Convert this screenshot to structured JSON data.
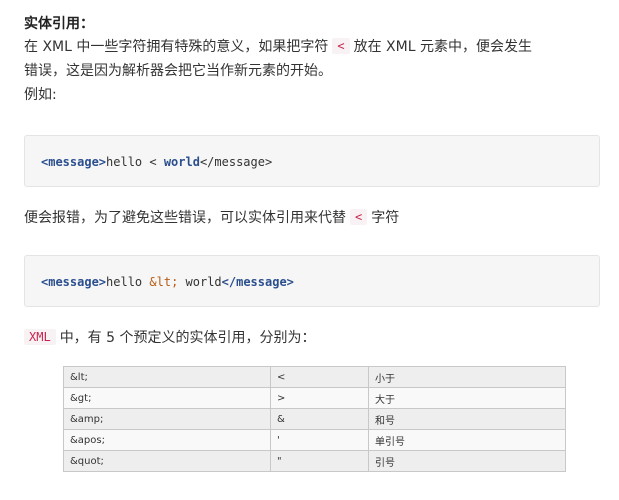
{
  "heading": "实体引用：",
  "intro": {
    "line1_before": "在 XML 中一些字符拥有特殊的意义，如果把字符",
    "line1_code": "<",
    "line1_after": "放在 XML 元素中，便会发生",
    "line2": "错误，这是因为解析器会把它当作新元素的开始。",
    "line3": "例如:"
  },
  "code1": {
    "open_tag": "<message>",
    "text": "hello < ",
    "word": "world",
    "close_tag": "</message>"
  },
  "middle": {
    "before": "便会报错，为了避免这些错误，可以实体引用来代替",
    "code": "<",
    "after": "字符"
  },
  "code2": {
    "open_tag": "<message>",
    "text_before": "hello ",
    "entity": "&lt;",
    "text_after": " world",
    "close_tag": "</message>"
  },
  "summary": {
    "code": "XML",
    "text": "中，有 5 个预定义的实体引用，分别为："
  },
  "entity_table": {
    "rows": [
      [
        "&lt;",
        "<",
        "小于"
      ],
      [
        "&gt;",
        ">",
        "大于"
      ],
      [
        "&amp;",
        "&",
        "和号"
      ],
      [
        "&apos;",
        "'",
        "单引号"
      ],
      [
        "&quot;",
        "\"",
        "引号"
      ]
    ]
  }
}
